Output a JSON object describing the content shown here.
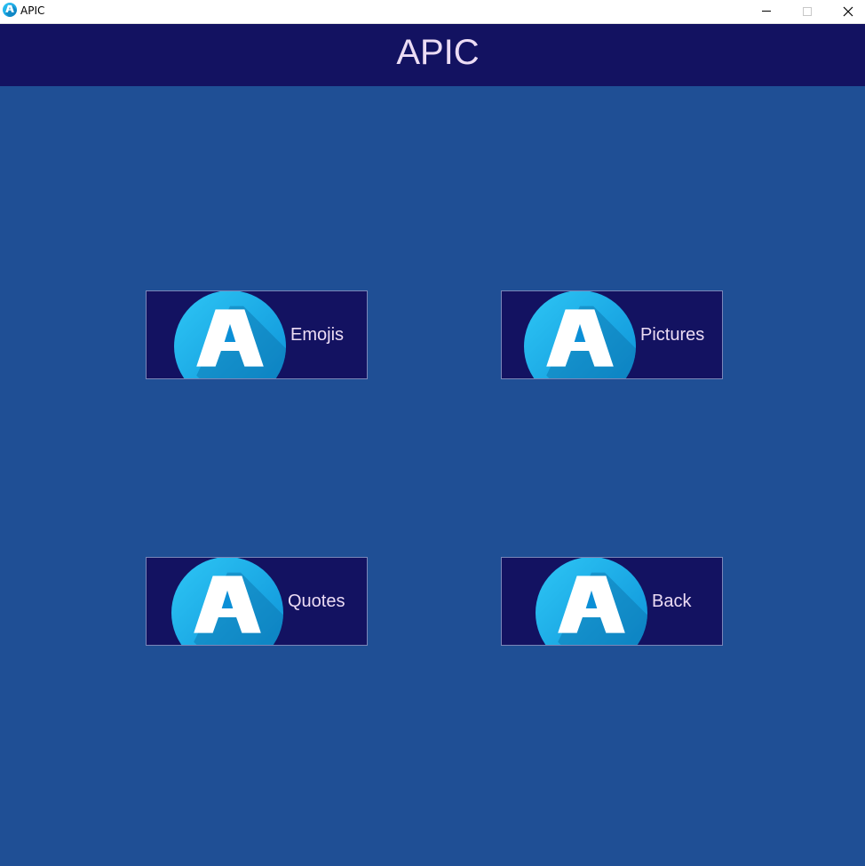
{
  "window": {
    "title": "APIC",
    "icon": "apic-logo-icon",
    "controls": [
      "minimize-icon",
      "maximize-icon",
      "close-icon"
    ]
  },
  "header": {
    "title": "APIC"
  },
  "buttons": {
    "emojis": {
      "label": "Emojis",
      "icon": "apic-logo-icon"
    },
    "pictures": {
      "label": "Pictures",
      "icon": "apic-logo-icon"
    },
    "quotes": {
      "label": "Quotes",
      "icon": "apic-logo-icon"
    },
    "back": {
      "label": "Back",
      "icon": "apic-logo-icon"
    }
  },
  "colors": {
    "background": "#1f4f95",
    "header": "#131261",
    "button": "#131261",
    "text": "#ecdcf4",
    "logo": "#1aa3e6"
  }
}
